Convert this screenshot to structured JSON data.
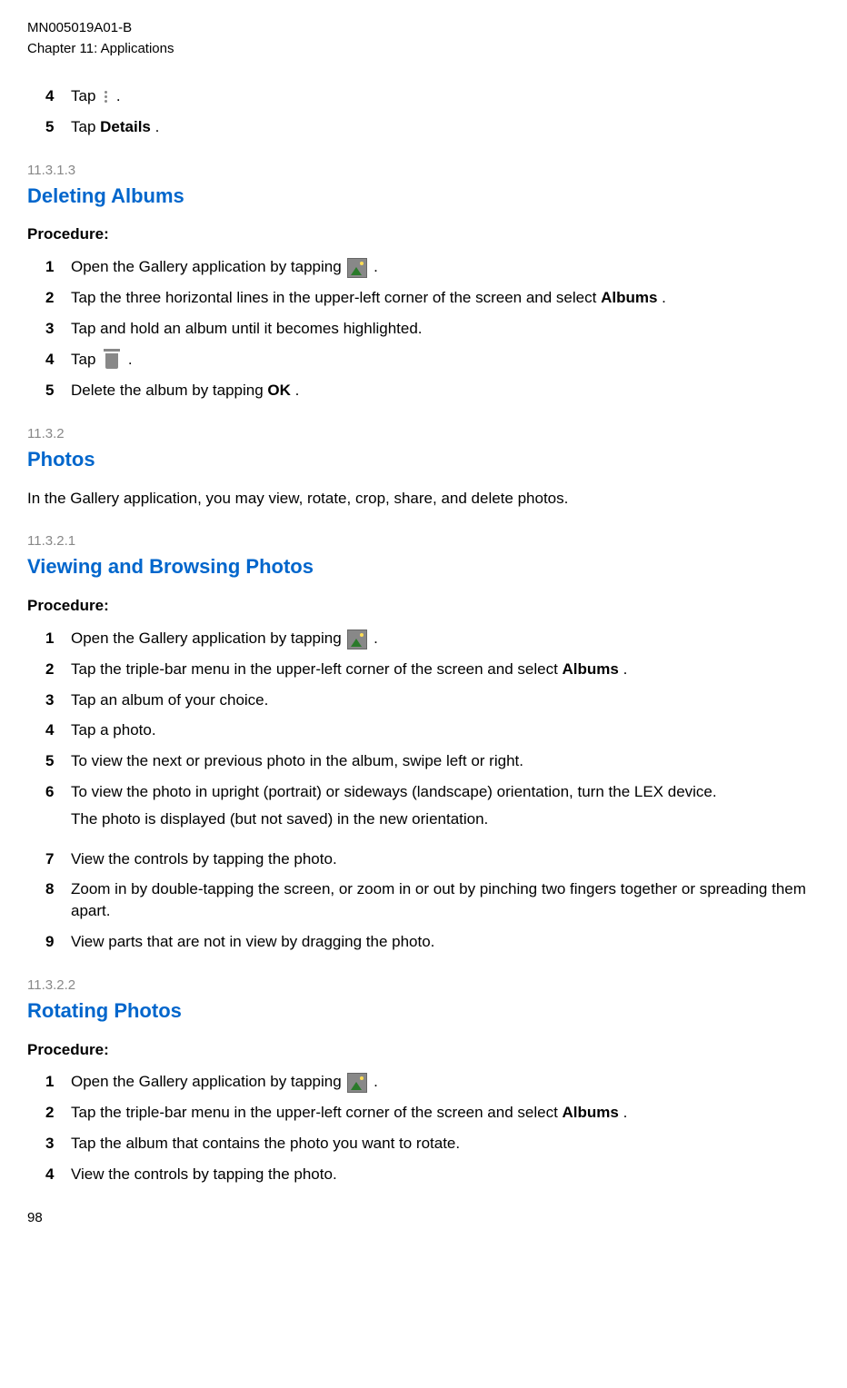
{
  "header": {
    "doc_id": "MN005019A01-B",
    "chapter": "Chapter 11:  Applications"
  },
  "top_steps": {
    "s4_pre": "Tap ",
    "s4_post": ".",
    "s5_pre": "Tap ",
    "s5_bold": "Details",
    "s5_post": "."
  },
  "sec_11_3_1_3": {
    "number": "11.3.1.3",
    "title": "Deleting Albums",
    "procedure": "Procedure:",
    "s1_pre": "Open the Gallery application by tapping ",
    "s1_post": ".",
    "s2_pre": "Tap the three horizontal lines in the upper-left corner of the screen and select ",
    "s2_bold": "Albums",
    "s2_post": ".",
    "s3": "Tap and hold an album until it becomes highlighted.",
    "s4_pre": "Tap ",
    "s4_post": ".",
    "s5_pre": "Delete the album by tapping ",
    "s5_bold": "OK",
    "s5_post": "."
  },
  "sec_11_3_2": {
    "number": "11.3.2",
    "title": "Photos",
    "intro": "In the Gallery application, you may view, rotate, crop, share, and delete photos."
  },
  "sec_11_3_2_1": {
    "number": "11.3.2.1",
    "title": "Viewing and Browsing Photos",
    "procedure": "Procedure:",
    "s1_pre": "Open the Gallery application by tapping ",
    "s1_post": ".",
    "s2_pre": "Tap the triple-bar menu in the upper-left corner of the screen and select ",
    "s2_bold": "Albums",
    "s2_post": ".",
    "s3": "Tap an album of your choice.",
    "s4": "Tap a photo.",
    "s5": "To view the next or previous photo in the album, swipe left or right.",
    "s6": "To view the photo in upright (portrait) or sideways (landscape) orientation, turn the LEX device.",
    "s6_sub": "The photo is displayed (but not saved) in the new orientation.",
    "s7": "View the controls by tapping the photo.",
    "s8": "Zoom in by double-tapping the screen, or zoom in or out by pinching two fingers together or spreading them apart.",
    "s9": "View parts that are not in view by dragging the photo."
  },
  "sec_11_3_2_2": {
    "number": "11.3.2.2",
    "title": "Rotating Photos",
    "procedure": "Procedure:",
    "s1_pre": "Open the Gallery application by tapping ",
    "s1_post": ".",
    "s2_pre": "Tap the triple-bar menu in the upper-left corner of the screen and select ",
    "s2_bold": "Albums",
    "s2_post": ".",
    "s3": "Tap the album that contains the photo you want to rotate.",
    "s4": "View the controls by tapping the photo."
  },
  "page_number": "98"
}
